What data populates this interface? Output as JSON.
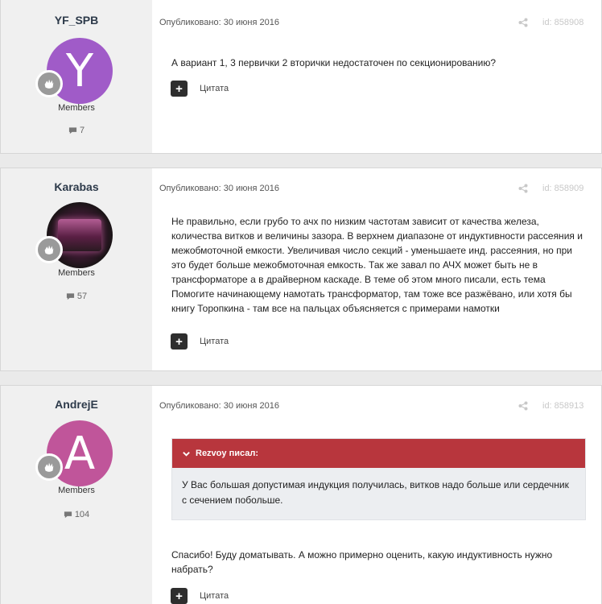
{
  "posts": [
    {
      "author": "YF_SPB",
      "avatar_letter": "Y",
      "avatar_color": "#a05bc8",
      "group": "Members",
      "post_count": "7",
      "published": "Опубликовано: 30 июня 2016",
      "post_id": "id: 858908",
      "content": "А вариант 1, 3 первички 2 вторички недостаточен по секционированию?",
      "quote_label": "Цитата"
    },
    {
      "author": "Karabas",
      "avatar_letter": "",
      "avatar_color": "#3a1a30",
      "group": "Members",
      "post_count": "57",
      "published": "Опубликовано: 30 июня 2016",
      "post_id": "id: 858909",
      "content": "Не правильно, если грубо то ачх по низким частотам зависит от качества железа, количества витков и величины зазора. В верхнем диапазоне от индуктивности рассеяния и межобмоточной емкости. Увеличивая число секций - уменьшаете инд. рассеяния, но при это будет больше межобмоточная емкость. Так же завал по АЧХ может быть не в трансформаторе а в драйверном каскаде. В теме об этом много писали, есть тема Помогите начинающему намотать трансформатор, там тоже все разжёвано, или хотя бы книгу Торопкина - там все на пальцах объясняется с примерами намотки",
      "quote_label": "Цитата"
    },
    {
      "author": "AndrejE",
      "avatar_letter": "A",
      "avatar_color": "#c0559a",
      "group": "Members",
      "post_count": "104",
      "published": "Опубликовано: 30 июня 2016",
      "post_id": "id: 858913",
      "quoted_author": "Rezvoy писал:",
      "quoted_text": "У Вас большая допустимая индукция получилась, витков надо больше или сердечник с сечением побольше.",
      "content": "Спасибо! Буду доматывать. А можно примерно оценить, какую индуктивность нужно набрать?",
      "quote_label": "Цитата"
    }
  ],
  "colors": {
    "quote_header": "#b8363d",
    "author_panel": "#f0f0f0",
    "page_bg": "#eaeaea"
  }
}
